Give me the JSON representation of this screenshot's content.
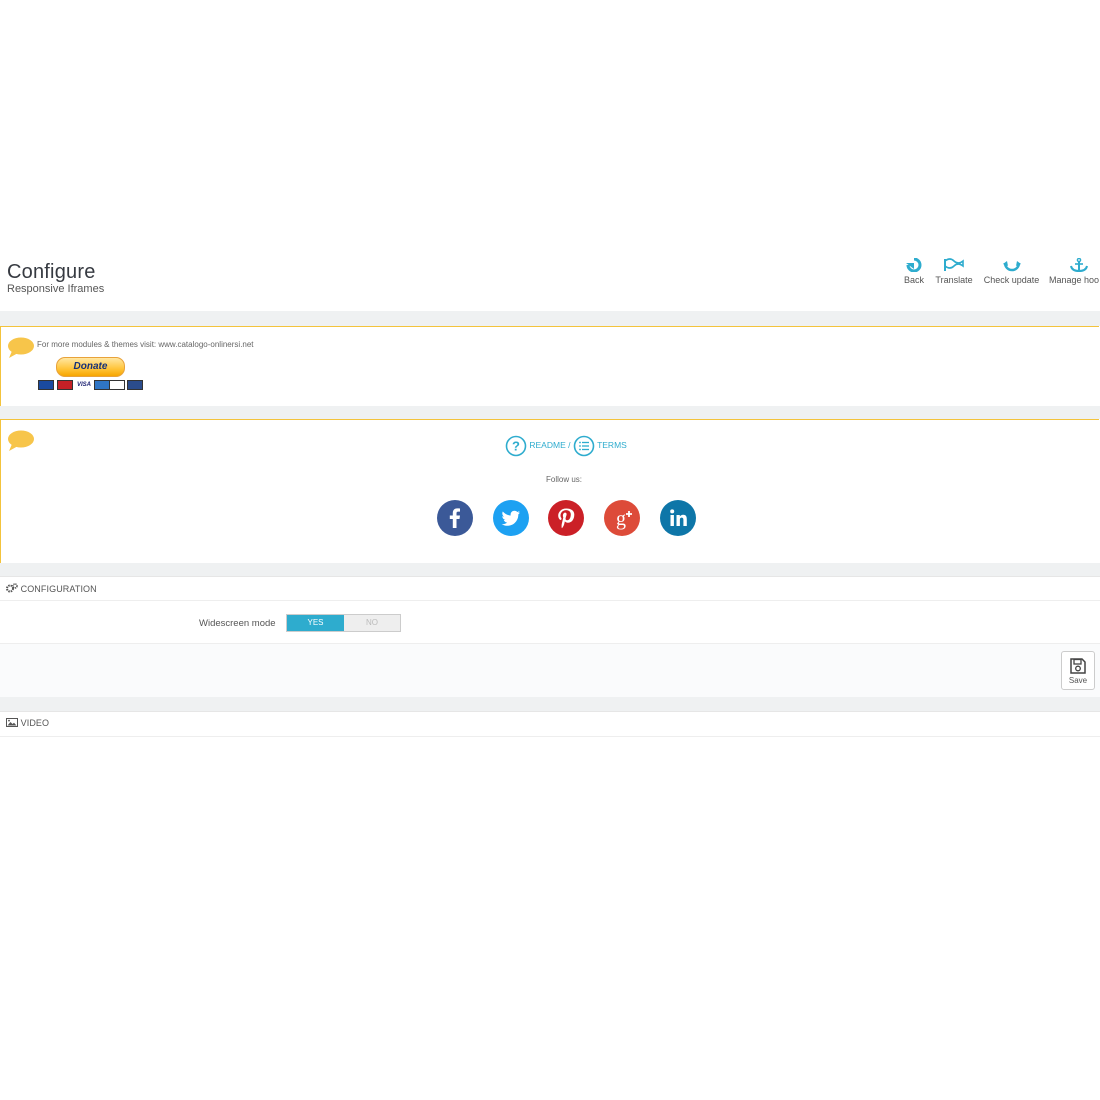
{
  "header": {
    "title": "Configure",
    "subtitle": "Responsive Iframes"
  },
  "toolbar": {
    "back": "Back",
    "translate": "Translate",
    "check_update": "Check update",
    "manage_hooks": "Manage hoo"
  },
  "promo": {
    "visit_text": "For more modules & themes visit: www.catalogo-onlinersi.net",
    "donate_label": "Donate"
  },
  "info": {
    "readme": "README /",
    "terms": "TERMS",
    "follow": "Follow us:",
    "social": [
      "facebook",
      "twitter",
      "pinterest",
      "google-plus",
      "linkedin"
    ]
  },
  "configuration": {
    "title": "CONFIGURATION",
    "widescreen_label": "Widescreen mode",
    "yes": "YES",
    "no": "NO",
    "selected": "YES",
    "save": "Save"
  },
  "video": {
    "title": "VIDEO"
  },
  "colors": {
    "accent": "#2eacce",
    "panel_border": "#f3c33c",
    "facebook": "#3b5998",
    "twitter": "#1da1f2",
    "pinterest": "#cb2027",
    "google_plus": "#dd4b39",
    "linkedin": "#0e76a8"
  }
}
